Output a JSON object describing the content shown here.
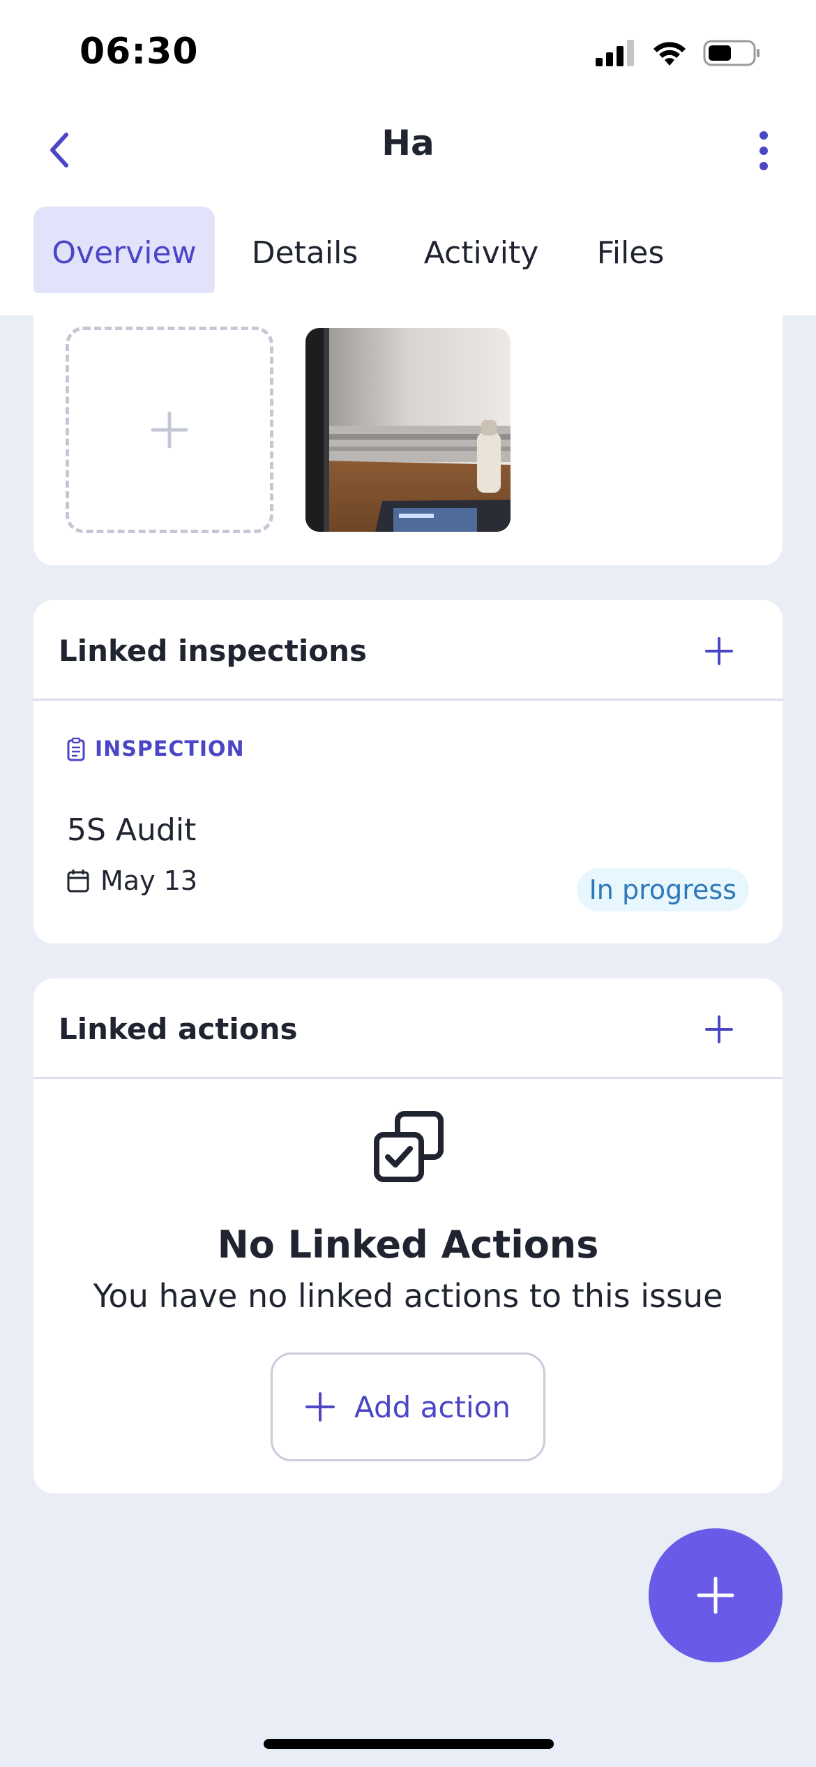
{
  "status_bar": {
    "time": "06:30"
  },
  "header": {
    "title": "Ha"
  },
  "tabs": [
    {
      "label": "Overview",
      "active": true
    },
    {
      "label": "Details",
      "active": false
    },
    {
      "label": "Activity",
      "active": false
    },
    {
      "label": "Files",
      "active": false
    }
  ],
  "linked_inspections": {
    "title": "Linked inspections",
    "item": {
      "type_label": "INSPECTION",
      "name": "5S Audit",
      "date": "May 13",
      "status": "In progress"
    }
  },
  "linked_actions": {
    "title": "Linked actions",
    "empty_title": "No Linked Actions",
    "empty_subtitle": "You have no linked actions to this issue",
    "add_button_label": "Add action"
  },
  "colors": {
    "accent": "#4a46c6",
    "fab": "#6a5ae8",
    "active_tab_bg": "#e2e3fb",
    "status_bg": "#e8f6fd",
    "status_text": "#2f79b8",
    "page_bg": "#e9edf5"
  }
}
